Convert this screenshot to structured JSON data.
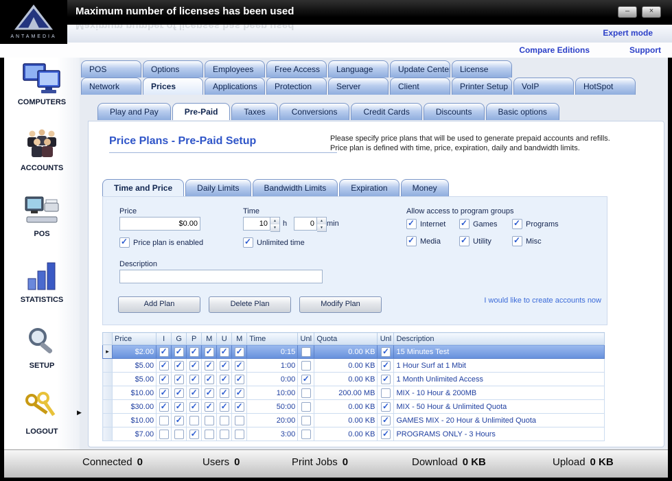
{
  "window": {
    "title": "Maximum number of licenses has been used",
    "brand": "ANTAMEDIA",
    "minimize_label": "–",
    "close_label": "×"
  },
  "header": {
    "expert_mode": "Expert mode",
    "compare_editions": "Compare Editions",
    "support": "Support"
  },
  "sidebar": {
    "items": [
      {
        "label": "COMPUTERS",
        "icon": "computers-icon"
      },
      {
        "label": "ACCOUNTS",
        "icon": "accounts-icon"
      },
      {
        "label": "POS",
        "icon": "pos-icon"
      },
      {
        "label": "STATISTICS",
        "icon": "statistics-icon"
      },
      {
        "label": "SETUP",
        "icon": "setup-icon"
      },
      {
        "label": "LOGOUT",
        "icon": "logout-icon"
      }
    ]
  },
  "tabs": {
    "row1": [
      "POS",
      "Options",
      "Employees",
      "Free Access",
      "Language",
      "Update Center",
      "License"
    ],
    "row1_active": -1,
    "row2": [
      "Network",
      "Prices",
      "Applications",
      "Protection",
      "Server",
      "Client",
      "Printer Setup",
      "VoIP",
      "HotSpot"
    ],
    "row2_active": 1,
    "subtabs": [
      "Play and Pay",
      "Pre-Paid",
      "Taxes",
      "Conversions",
      "Credit Cards",
      "Discounts",
      "Basic options"
    ],
    "subtabs_active": 1,
    "inner": [
      "Time and Price",
      "Daily Limits",
      "Bandwidth Limits",
      "Expiration",
      "Money"
    ],
    "inner_active": 0
  },
  "page": {
    "title": "Price Plans - Pre-Paid Setup",
    "info_line1": "Please specify price plans that will be used to generate prepaid accounts and refills.",
    "info_line2": "Price plan is defined with time, price, expiration, daily and bandwidth limits."
  },
  "form": {
    "price_label": "Price",
    "price_value": "$0.00",
    "price_enabled_label": "Price plan is enabled",
    "price_enabled_checked": true,
    "time_label": "Time",
    "hours_value": "10",
    "hours_unit": "h",
    "minutes_value": "0",
    "minutes_unit": "min",
    "unlimited_time_label": "Unlimited time",
    "unlimited_time_checked": true,
    "groups_label": "Allow access to program groups",
    "groups": [
      {
        "label": "Internet",
        "checked": true
      },
      {
        "label": "Games",
        "checked": true
      },
      {
        "label": "Programs",
        "checked": true
      },
      {
        "label": "Media",
        "checked": true
      },
      {
        "label": "Utility",
        "checked": true
      },
      {
        "label": "Misc",
        "checked": true
      }
    ],
    "description_label": "Description",
    "description_value": ""
  },
  "actions": {
    "add": "Add Plan",
    "delete": "Delete Plan",
    "modify": "Modify Plan",
    "create_link": "I would like to create accounts now"
  },
  "table": {
    "columns": [
      "Price",
      "I",
      "G",
      "P",
      "M",
      "U",
      "M",
      "Time",
      "Unl",
      "Quota",
      "Unl",
      "Description"
    ],
    "rows": [
      {
        "price": "$2.00",
        "flags": [
          true,
          true,
          true,
          true,
          true,
          true
        ],
        "time": "0:15",
        "unl_time": false,
        "quota": "0.00 KB",
        "unl_quota": true,
        "description": "15 Minutes Test",
        "selected": true
      },
      {
        "price": "$5.00",
        "flags": [
          true,
          true,
          true,
          true,
          true,
          true
        ],
        "time": "1:00",
        "unl_time": false,
        "quota": "0.00 KB",
        "unl_quota": true,
        "description": "1 Hour Surf at 1 Mbit",
        "selected": false
      },
      {
        "price": "$5.00",
        "flags": [
          true,
          true,
          true,
          true,
          true,
          true
        ],
        "time": "0:00",
        "unl_time": true,
        "quota": "0.00 KB",
        "unl_quota": true,
        "description": "1 Month Unlimited Access",
        "selected": false
      },
      {
        "price": "$10.00",
        "flags": [
          true,
          true,
          true,
          true,
          true,
          true
        ],
        "time": "10:00",
        "unl_time": false,
        "quota": "200.00 MB",
        "unl_quota": false,
        "description": "MIX - 10 Hour & 200MB",
        "selected": false
      },
      {
        "price": "$30.00",
        "flags": [
          true,
          true,
          true,
          true,
          true,
          true
        ],
        "time": "50:00",
        "unl_time": false,
        "quota": "0.00 KB",
        "unl_quota": true,
        "description": "MIX - 50 Hour & Unlimited Quota",
        "selected": false
      },
      {
        "price": "$10.00",
        "flags": [
          false,
          true,
          false,
          false,
          false,
          false
        ],
        "time": "20:00",
        "unl_time": false,
        "quota": "0.00 KB",
        "unl_quota": true,
        "description": "GAMES MIX - 20 Hour & Unlimited Quota",
        "selected": false
      },
      {
        "price": "$7.00",
        "flags": [
          false,
          false,
          true,
          false,
          false,
          false
        ],
        "time": "3:00",
        "unl_time": false,
        "quota": "0.00 KB",
        "unl_quota": true,
        "description": "PROGRAMS ONLY - 3 Hours",
        "selected": false
      }
    ]
  },
  "statusbar": {
    "items": [
      {
        "label": "Connected",
        "value": "0"
      },
      {
        "label": "Users",
        "value": "0"
      },
      {
        "label": "Print Jobs",
        "value": "0"
      },
      {
        "label": "Download",
        "value": "0 KB"
      },
      {
        "label": "Upload",
        "value": "0 KB"
      }
    ]
  }
}
